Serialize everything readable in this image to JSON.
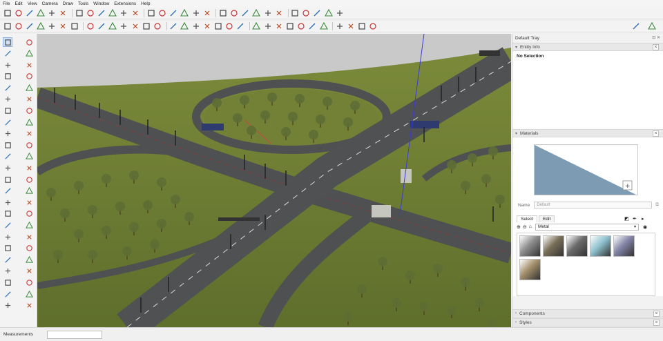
{
  "menu": [
    "File",
    "Edit",
    "View",
    "Camera",
    "Draw",
    "Tools",
    "Window",
    "Extensions",
    "Help"
  ],
  "toolbar_top_icons": [
    "open-icon",
    "settings-icon",
    "x-icon",
    "circle-icon",
    "pentagon-icon",
    "drop-icon",
    "drop-icon",
    "drop-icon",
    "drop-icon",
    "drop-icon",
    "drop-icon",
    "pentagon-icon",
    "hexagon-icon",
    "hexagon-icon",
    "hexagon-icon",
    "hexagon-icon",
    "hexagon-icon",
    "point-icon",
    "hand-icon",
    "add-circle-icon",
    "line-icon",
    "wrench-icon",
    "stack-icon",
    "stack-icon",
    "stack-icon",
    "stack-icon",
    "stack-icon",
    "layers-icon",
    "arrow-target-icon"
  ],
  "toolbar_second_icons": [
    "search-icon",
    "select-icon",
    "eraser-icon",
    "paint-icon",
    "pencil-icon",
    "rect-icon",
    "move-icon",
    "rotate-icon",
    "scale-icon",
    "pushpull-icon",
    "offset-icon",
    "orbit-icon",
    "pan-icon",
    "zoom-icon",
    "zoom-extents-icon",
    "style-icon",
    "style-icon",
    "style-icon",
    "section-icon",
    "section-icon",
    "camera-icon",
    "view-iso-icon",
    "view-top-icon",
    "view-front-icon",
    "view-right-icon",
    "view-back-icon",
    "view-left-icon",
    "image-icon",
    "tool-icon",
    "tool-icon",
    "tool-icon",
    "sparkle-icon"
  ],
  "toolbar_right_icons": [
    "document-icon",
    "user-icon"
  ],
  "left_tools": [
    "select-arrow-icon",
    "line-pencil-icon",
    "paint-bucket-icon",
    "eraser-icon",
    "tape-measure-icon",
    "protractor-icon",
    "freehand-icon",
    "arc-icon",
    "rectangle-icon",
    "rotated-rect-icon",
    "circle-icon",
    "polygon-icon",
    "pushpull-icon",
    "follow-me-icon",
    "move-icon",
    "rotate-icon",
    "scale-icon",
    "offset-icon",
    "tape-icon",
    "dimension-icon",
    "protractor-icon",
    "text-icon",
    "axes-icon",
    "3d-text-icon",
    "orbit-icon",
    "pan-icon",
    "zoom-icon",
    "zoom-window-icon",
    "zoom-extents-icon",
    "previous-view-icon",
    "section-plane-icon",
    "walk-icon",
    "look-around-icon",
    "position-camera-icon",
    "sandbox-icon",
    "smoove-icon",
    "stamp-icon",
    "drape-icon",
    "add-detail-icon",
    "flip-edge-icon",
    "warehouse-icon",
    "extension-icon",
    "layer-icon",
    "component-icon",
    "styles-icon",
    "scenes-icon",
    "shadow-icon",
    "fog-icon"
  ],
  "tray": {
    "title": "Default Tray",
    "pin": "⊡ ✕",
    "entity_info": {
      "header": "Entity Info",
      "selection": "No Selection"
    },
    "materials": {
      "header": "Materials",
      "name_label": "Name",
      "name_value": "Default",
      "tabs": [
        "Select",
        "Edit"
      ],
      "category": "Metal",
      "swatches": [
        {
          "color": "#8d8d8d",
          "name": "metal-steel"
        },
        {
          "color": "#7a7059",
          "name": "metal-bronze"
        },
        {
          "color": "#6b6b6b",
          "name": "metal-dark"
        },
        {
          "color": "#8fc3cf",
          "name": "metal-aqua"
        },
        {
          "color": "#8485a8",
          "name": "metal-violet"
        },
        {
          "color": "#a38f6a",
          "name": "metal-gold"
        }
      ]
    },
    "components_header": "Components",
    "styles_header": "Styles"
  },
  "status": {
    "measurements_label": "Measurements",
    "measurements_value": ""
  },
  "colors": {
    "sky": "#c9c9c9",
    "grass": "#6b7a33",
    "road": "#4e5052",
    "swatch_fill": "#7e9bb4"
  }
}
